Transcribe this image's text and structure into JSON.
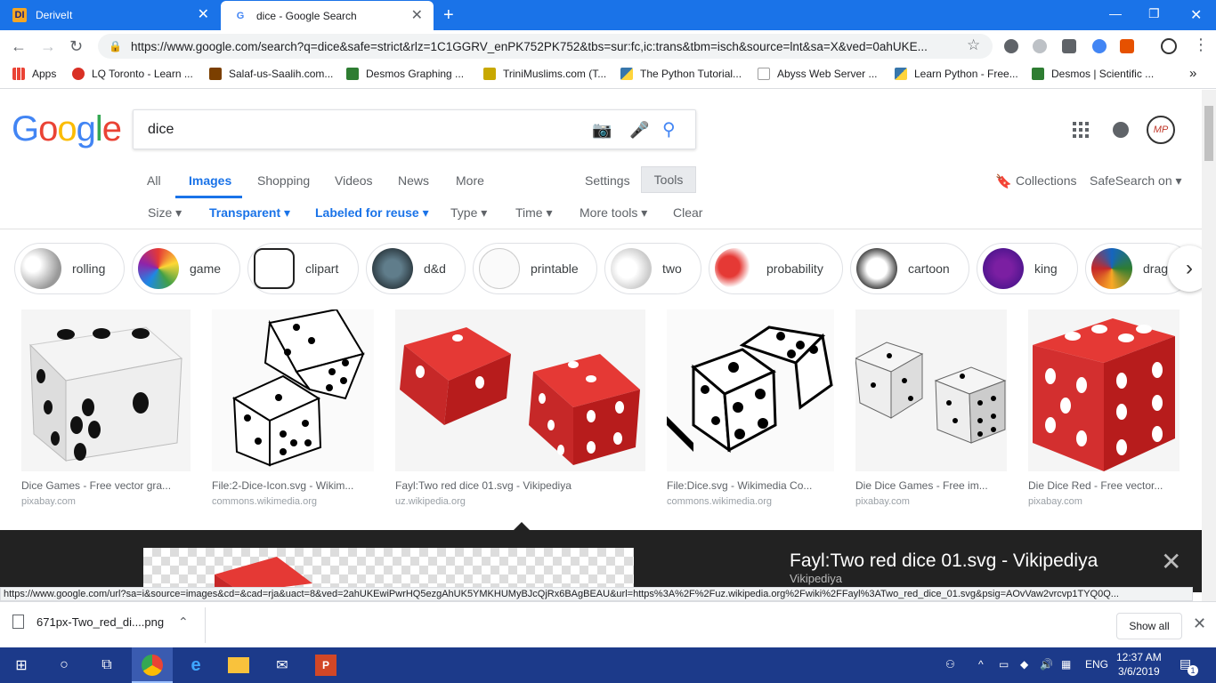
{
  "browser": {
    "tabs": [
      {
        "title": "DeriveIt",
        "favicon": "DI"
      },
      {
        "title": "dice - Google Search",
        "favicon": "G"
      }
    ],
    "url": "https://www.google.com/search?q=dice&safe=strict&rlz=1C1GGRV_enPK752PK752&tbs=sur:fc,ic:trans&tbm=isch&source=lnt&sa=X&ved=0ahUKE...",
    "bookmarks": [
      {
        "label": "Apps",
        "color": "#5f6368"
      },
      {
        "label": "LQ Toronto - Learn ...",
        "color": "#d93025"
      },
      {
        "label": "Salaf-us-Saalih.com...",
        "color": "#7b3f00"
      },
      {
        "label": "Desmos Graphing ...",
        "color": "#2e7d32"
      },
      {
        "label": "TriniMuslims.com (T...",
        "color": "#c8a800"
      },
      {
        "label": "The Python Tutorial...",
        "color": "#3776ab"
      },
      {
        "label": "Abyss Web Server ...",
        "color": "#9e9e9e"
      },
      {
        "label": "Learn Python - Free...",
        "color": "#3776ab"
      },
      {
        "label": "Desmos | Scientific ...",
        "color": "#2e7d32"
      }
    ]
  },
  "google": {
    "logo": [
      "G",
      "o",
      "o",
      "g",
      "l",
      "e"
    ],
    "logo_colors": [
      "#4285f4",
      "#ea4335",
      "#fbbc05",
      "#4285f4",
      "#34a853",
      "#ea4335"
    ],
    "query": "dice",
    "nav": {
      "all": "All",
      "images": "Images",
      "shopping": "Shopping",
      "videos": "Videos",
      "news": "News",
      "more": "More",
      "settings": "Settings",
      "tools": "Tools",
      "collections": "Collections",
      "safesearch": "SafeSearch on ▾"
    },
    "tools": {
      "size": "Size ▾",
      "transparent": "Transparent ▾",
      "labeled": "Labeled for reuse ▾",
      "type": "Type ▾",
      "time": "Time ▾",
      "more_tools": "More tools ▾",
      "clear": "Clear"
    },
    "chips": [
      "rolling",
      "game",
      "clipart",
      "d&d",
      "printable",
      "two",
      "probability",
      "cartoon",
      "king",
      "drago"
    ],
    "results": [
      {
        "title": "Dice Games - Free vector gra...",
        "source": "pixabay.com"
      },
      {
        "title": "File:2-Dice-Icon.svg - Wikim...",
        "source": "commons.wikimedia.org"
      },
      {
        "title": "Fayl:Two red dice 01.svg - Vikipediya",
        "source": "uz.wikipedia.org"
      },
      {
        "title": "File:Dice.svg - Wikimedia Co...",
        "source": "commons.wikimedia.org"
      },
      {
        "title": "Die Dice Games - Free im...",
        "source": "pixabay.com"
      },
      {
        "title": "Die Dice Red - Free vector...",
        "source": "pixabay.com"
      }
    ],
    "preview": {
      "title": "Fayl:Two red dice 01.svg - Vikipediya",
      "site": "Vikipediya"
    }
  },
  "status_url": "https://www.google.com/url?sa=i&source=images&cd=&cad=rja&uact=8&ved=2ahUKEwiPwrHQ5ezgAhUK5YMKHUMyBJcQjRx6BAgBEAU&url=https%3A%2F%2Fuz.wikipedia.org%2Fwiki%2FFayl%3ATwo_red_dice_01.svg&psig=AOvVaw2vrcvp1TYQ0Q...",
  "downloads": {
    "file": "671px-Two_red_di....png",
    "show_all": "Show all"
  },
  "taskbar": {
    "lang": "ENG",
    "time": "12:37 AM",
    "date": "3/6/2019",
    "notif_count": "1"
  }
}
